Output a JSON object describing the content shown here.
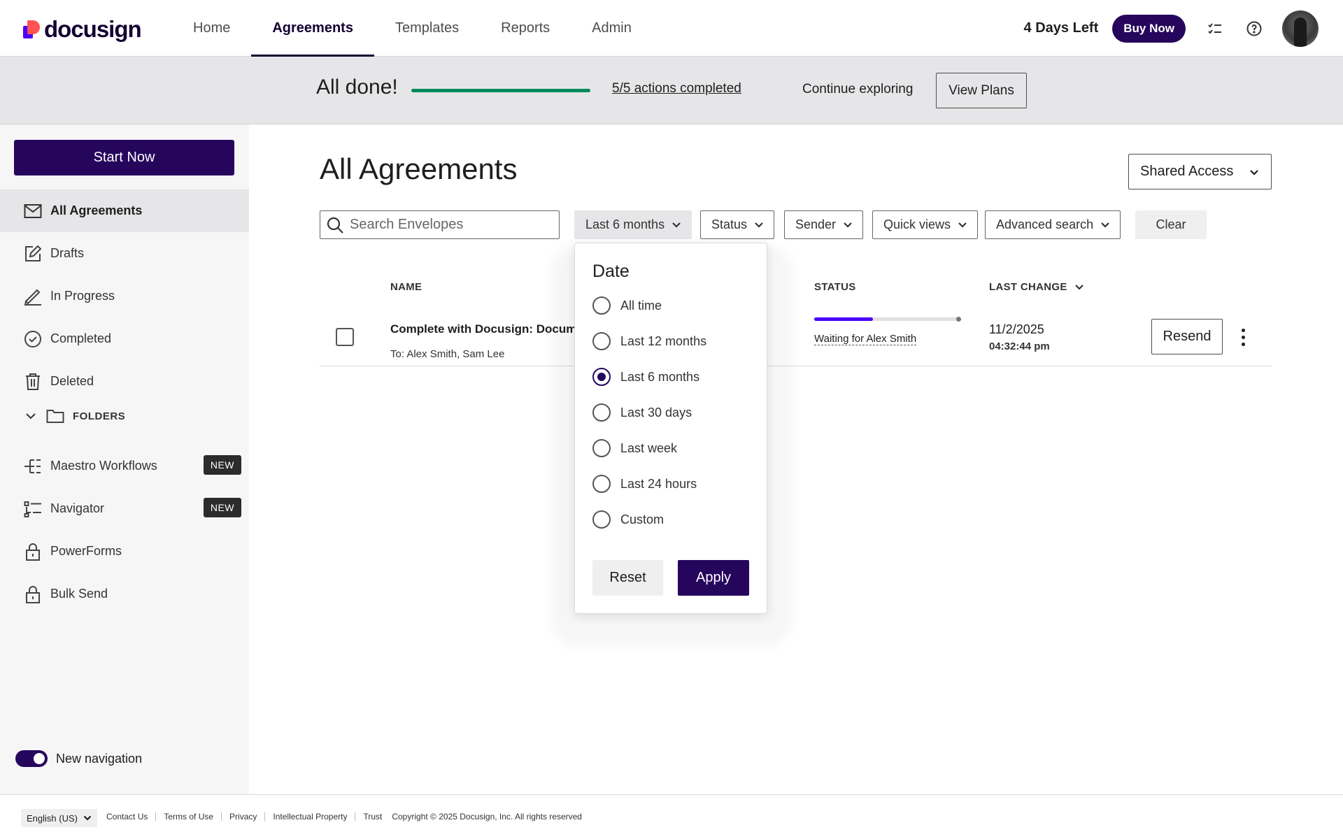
{
  "brand": {
    "name": "docusign",
    "accent": "#26065d",
    "logo_red": "#ff5252",
    "logo_purple": "#4c00ff"
  },
  "topnav": {
    "tabs": [
      {
        "label": "Home",
        "active": false
      },
      {
        "label": "Agreements",
        "active": true
      },
      {
        "label": "Templates",
        "active": false
      },
      {
        "label": "Reports",
        "active": false
      },
      {
        "label": "Admin",
        "active": false
      }
    ],
    "trial_text": "4 Days Left",
    "buy_label": "Buy Now",
    "icons": [
      "checklist-icon",
      "help-icon"
    ]
  },
  "banner": {
    "done_text": "All done!",
    "progress_fraction": 1.0,
    "progress_color": "#008a5b",
    "actions_link": "5/5 actions completed",
    "continue_text": "Continue exploring",
    "plans_label": "View Plans"
  },
  "sidebar": {
    "start_label": "Start Now",
    "items": [
      {
        "label": "All Agreements",
        "icon": "envelope-icon",
        "active": true
      },
      {
        "label": "Drafts",
        "icon": "draft-edit-icon",
        "active": false
      },
      {
        "label": "In Progress",
        "icon": "pen-icon",
        "active": false
      },
      {
        "label": "Completed",
        "icon": "check-circle-icon",
        "active": false
      },
      {
        "label": "Deleted",
        "icon": "trash-icon",
        "active": false
      }
    ],
    "folders_label": "FOLDERS",
    "extra_items": [
      {
        "label": "Maestro Workflows",
        "icon": "workflow-icon",
        "badge": "NEW"
      },
      {
        "label": "Navigator",
        "icon": "navigator-list-icon",
        "badge": "NEW"
      },
      {
        "label": "PowerForms",
        "icon": "lock-icon",
        "badge": ""
      },
      {
        "label": "Bulk Send",
        "icon": "lock-icon",
        "badge": ""
      }
    ],
    "toggle_label": "New navigation",
    "toggle_on": true
  },
  "main": {
    "title": "All Agreements",
    "shared_access_label": "Shared Access",
    "search_placeholder": "Search Envelopes",
    "filters": {
      "date": "Last 6 months",
      "status": "Status",
      "sender": "Sender",
      "quick_views": "Quick views",
      "advanced": "Advanced search",
      "clear": "Clear"
    },
    "columns": {
      "name": "NAME",
      "status": "STATUS",
      "last_change": "LAST CHANGE"
    },
    "rows": [
      {
        "name": "Complete with Docusign: Docume",
        "to": "To: Alex Smith, Sam Lee",
        "status_progress": 0.4,
        "status_text": "Waiting for Alex Smith",
        "date": "11/2/2025",
        "time": "04:32:44 pm",
        "action": "Resend"
      }
    ]
  },
  "date_dropdown": {
    "title": "Date",
    "options": [
      {
        "label": "All time",
        "checked": false
      },
      {
        "label": "Last 12 months",
        "checked": false
      },
      {
        "label": "Last 6 months",
        "checked": true
      },
      {
        "label": "Last 30 days",
        "checked": false
      },
      {
        "label": "Last week",
        "checked": false
      },
      {
        "label": "Last 24 hours",
        "checked": false
      },
      {
        "label": "Custom",
        "checked": false
      }
    ],
    "reset_label": "Reset",
    "apply_label": "Apply"
  },
  "footer": {
    "language": "English (US)",
    "links": [
      "Contact Us",
      "Terms of Use",
      "Privacy",
      "Intellectual Property",
      "Trust"
    ],
    "copyright": "Copyright © 2025 Docusign, Inc. All rights reserved"
  }
}
